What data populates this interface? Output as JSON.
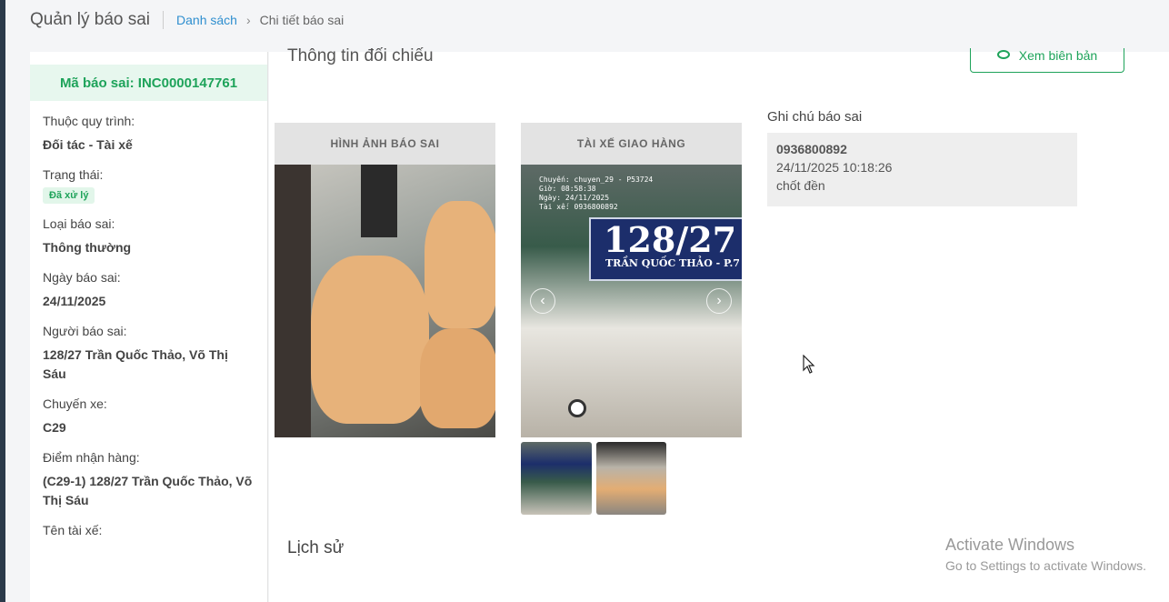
{
  "header": {
    "title": "Quản lý báo sai",
    "breadcrumb_link": "Danh sách",
    "breadcrumb_current": "Chi tiết báo sai"
  },
  "sidebar": {
    "code": "Mã báo sai: INC0000147761",
    "fields": [
      {
        "label": "Thuộc quy trình:",
        "value": "Đối tác - Tài xế"
      },
      {
        "label": "Trạng thái:",
        "badge": "Đã xử lý"
      },
      {
        "label": "Loại báo sai:",
        "value": "Thông thường"
      },
      {
        "label": "Ngày báo sai:",
        "value": "24/11/2025"
      },
      {
        "label": "Người báo sai:",
        "value": "128/27 Trần Quốc Thảo, Võ Thị Sáu"
      },
      {
        "label": "Chuyến xe:",
        "value": "C29"
      },
      {
        "label": "Điểm nhận hàng:",
        "value": "(C29-1) 128/27 Trần Quốc Thảo, Võ Thị Sáu"
      },
      {
        "label": "Tên tài xế:",
        "value": ""
      }
    ]
  },
  "main": {
    "section_title": "Thông tin đối chiếu",
    "view_button": "Xem biên bản",
    "image_reported": "HÌNH ẢNH BÁO SAI",
    "image_driver": "TÀI XẾ GIAO HÀNG",
    "sign_number": "128/27",
    "sign_street": "TRẦN QUỐC THẢO - P.7",
    "stamp_lines": [
      "Chuyến: chuyen_29 - P53724",
      "Giờ: 08:58:38",
      "Ngày: 24/11/2025",
      "Tài xế: 0936800892"
    ],
    "note_title": "Ghi chú báo sai",
    "note": {
      "phone": "0936800892",
      "time": "24/11/2025 10:18:26",
      "text": "chốt đền"
    },
    "history_title": "Lịch sử"
  },
  "watermark": {
    "line1": "Activate Windows",
    "line2": "Go to Settings to activate Windows."
  },
  "colors": {
    "accent": "#1ea35a",
    "link": "#2f8fcf"
  }
}
